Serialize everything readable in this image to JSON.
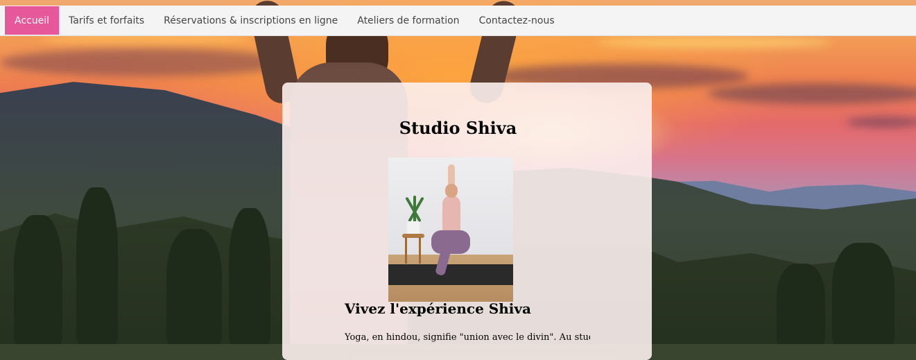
{
  "nav": {
    "items": [
      {
        "label": "Accueil",
        "active": true
      },
      {
        "label": "Tarifs et forfaits",
        "active": false
      },
      {
        "label": "Réservations & inscriptions en ligne",
        "active": false
      },
      {
        "label": "Ateliers de formation",
        "active": false
      },
      {
        "label": "Contactez-nous",
        "active": false
      }
    ],
    "active_color": "#e7589a"
  },
  "hero": {
    "title": "Studio Shiva",
    "subtitle": "Vivez l'expérience Shiva",
    "intro": "Yoga, en hindou, signifie \"union avec le divin\". Au studio"
  }
}
